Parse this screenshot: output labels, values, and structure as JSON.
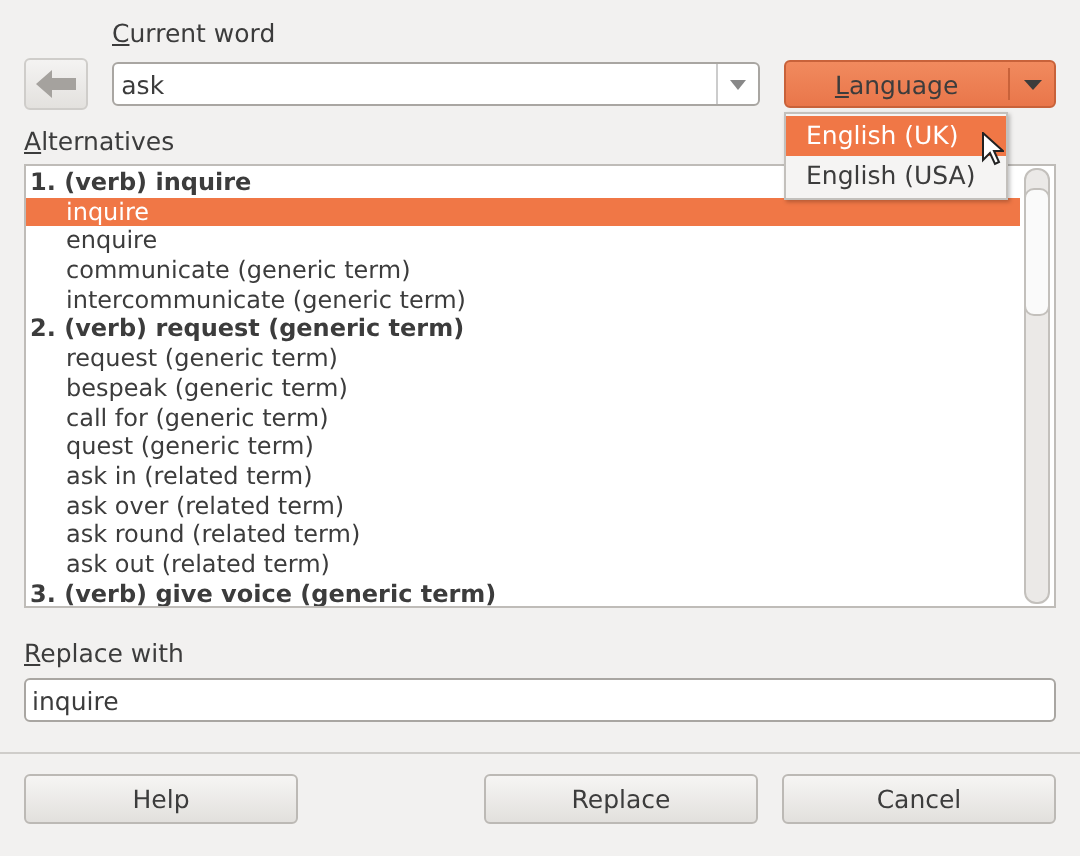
{
  "current_word": {
    "label": "Current word",
    "value": "ask"
  },
  "language": {
    "label": "Language",
    "options": [
      {
        "label": "English (UK)",
        "selected": true
      },
      {
        "label": "English (USA)",
        "selected": false
      }
    ]
  },
  "alternatives": {
    "label": "Alternatives",
    "groups": [
      {
        "label": "1. (verb) inquire",
        "children": [
          {
            "label": "inquire",
            "selected": true
          },
          {
            "label": "enquire",
            "selected": false
          },
          {
            "label": "communicate (generic term)",
            "selected": false
          },
          {
            "label": "intercommunicate (generic term)",
            "selected": false
          }
        ]
      },
      {
        "label": "2. (verb) request (generic term)",
        "children": [
          {
            "label": "request (generic term)",
            "selected": false
          },
          {
            "label": "bespeak (generic term)",
            "selected": false
          },
          {
            "label": "call for (generic term)",
            "selected": false
          },
          {
            "label": "quest (generic term)",
            "selected": false
          },
          {
            "label": "ask in (related term)",
            "selected": false
          },
          {
            "label": "ask over (related term)",
            "selected": false
          },
          {
            "label": "ask round (related term)",
            "selected": false
          },
          {
            "label": "ask out (related term)",
            "selected": false
          }
        ]
      },
      {
        "label": "3. (verb) give voice (generic term)"
      }
    ]
  },
  "replace_with": {
    "label": "Replace with",
    "value": "inquire"
  },
  "buttons": [
    {
      "label": "Help",
      "kind": "left"
    },
    {
      "label": "Replace",
      "kind": "right"
    },
    {
      "label": "Cancel",
      "kind": "right"
    }
  ]
}
